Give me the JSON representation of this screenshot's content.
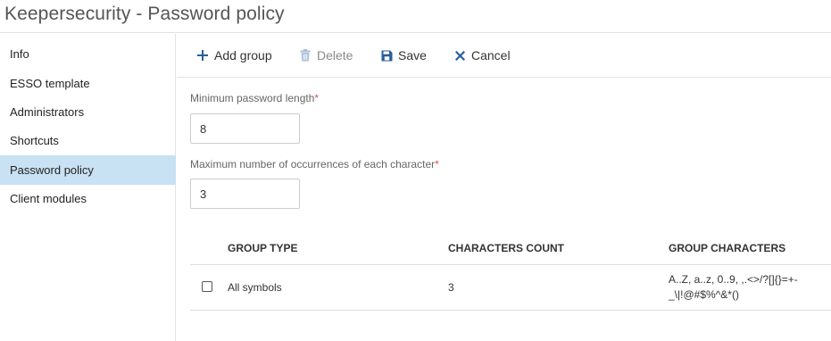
{
  "app": {
    "title": "Keepersecurity - Password policy"
  },
  "sidebar": {
    "items": [
      {
        "label": "Info",
        "active": false
      },
      {
        "label": "ESSO template",
        "active": false
      },
      {
        "label": "Administrators",
        "active": false
      },
      {
        "label": "Shortcuts",
        "active": false
      },
      {
        "label": "Password policy",
        "active": true
      },
      {
        "label": "Client modules",
        "active": false
      }
    ]
  },
  "toolbar": {
    "add_group": {
      "label": "Add group",
      "icon": "plus-icon"
    },
    "delete": {
      "label": "Delete",
      "icon": "trash-icon",
      "disabled": true
    },
    "save": {
      "label": "Save",
      "icon": "floppy-disk-icon"
    },
    "cancel": {
      "label": "Cancel",
      "icon": "x-icon"
    }
  },
  "form": {
    "min_length": {
      "label": "Minimum password length",
      "required_mark": "*",
      "value": "8"
    },
    "max_occurrences": {
      "label": "Maximum number of occurrences of each character",
      "required_mark": "*",
      "value": "3"
    }
  },
  "table": {
    "columns": [
      "GROUP TYPE",
      "CHARACTERS COUNT",
      "GROUP CHARACTERS"
    ],
    "rows": [
      {
        "checked": false,
        "group_type": "All symbols",
        "characters_count": "3",
        "group_characters_line1": "A..Z, a..z, 0..9, ,.<>/?[]{}=+-",
        "group_characters_line2": "_\\|!@#$%^&*()"
      }
    ]
  },
  "colors": {
    "active_sidebar_bg": "#c8e1f3",
    "toolbar_icon": "#2a5e9c",
    "required_mark": "#d9534f",
    "disabled_text": "#8a8a8a"
  }
}
